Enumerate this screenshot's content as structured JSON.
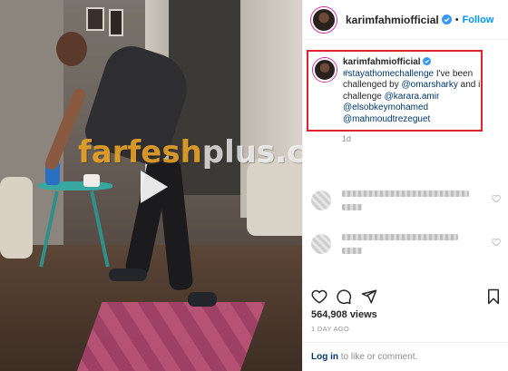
{
  "post": {
    "username": "karimfahmiofficial",
    "dot": "•",
    "follow_label": "Follow",
    "caption_username": "karimfahmiofficial",
    "caption_hashtag": "#stayathomechallenge",
    "caption_text_1": " I've been challenged by ",
    "mention_1": "@omarsharky",
    "caption_text_2": " and i challenge ",
    "mention_2": "@karara.amir",
    "mention_3": "@elsobkeymohamed",
    "mention_4": "@mahmoudtrezeguet",
    "caption_time": "1d",
    "views": "564,908 views",
    "time_ago": "1 DAY AGO",
    "footer_login": "Log in",
    "footer_text": " to like or comment."
  },
  "watermark": {
    "main": "farfesh",
    "suffix": "plus.com"
  },
  "icons": [
    "verified-badge-icon",
    "play-icon",
    "heart-icon",
    "comment-icon",
    "share-icon",
    "bookmark-icon"
  ],
  "colors": {
    "follow_blue": "#0095f6",
    "highlight_red": "#e2232b",
    "hashtag_blue": "#00376b",
    "watermark_orange": "#f5aa28"
  }
}
